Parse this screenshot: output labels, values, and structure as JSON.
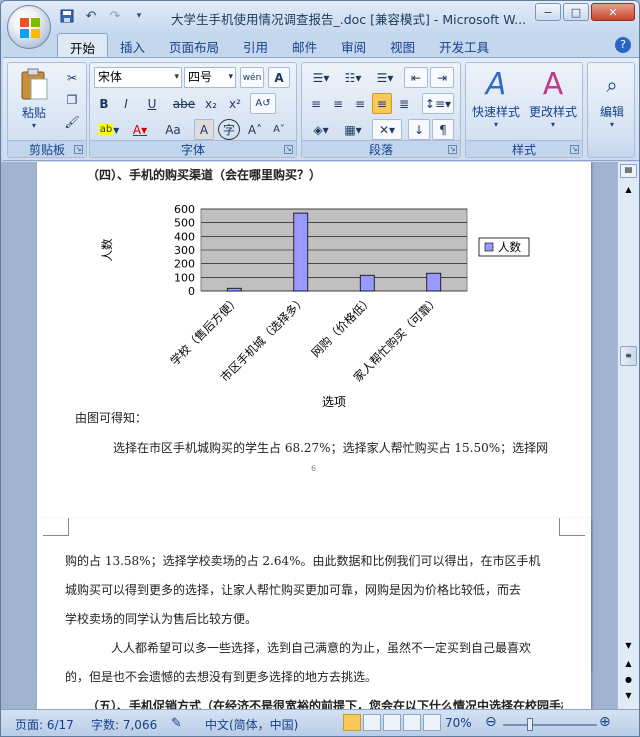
{
  "window": {
    "title": "大学生手机使用情况调查报告_.doc [兼容模式] - Microsoft W...",
    "min": "−",
    "max": "□",
    "close": "✕"
  },
  "qat": {
    "save_icon": "save-icon",
    "undo": "↶",
    "redo": "↷",
    "more": "▾"
  },
  "tabs": [
    "开始",
    "插入",
    "页面布局",
    "引用",
    "邮件",
    "审阅",
    "视图",
    "开发工具"
  ],
  "ribbon": {
    "clipboard": {
      "label": "剪贴板",
      "paste": "粘贴"
    },
    "font": {
      "label": "字体",
      "font_name": "宋体",
      "font_size": "四号",
      "wen": "wén",
      "a_box": "A",
      "bold": "B",
      "italic": "I",
      "underline": "U",
      "strike": "abe",
      "sub": "x₂",
      "sup": "x²",
      "aa": "Aa",
      "grow": "A˄",
      "shrink": "A˅",
      "char_shade": "A",
      "phonetic": "字"
    },
    "paragraph": {
      "label": "段落"
    },
    "styles": {
      "label": "样式",
      "quick": "快速样式",
      "change": "更改样式"
    },
    "editing": {
      "label": "编辑"
    }
  },
  "doc": {
    "heading_top": "（四）、手机的购买渠道（会在哪里购买？）",
    "after_chart": "由图可得知：",
    "para1_line1": "选择在市区手机城购买的学生占 68.27%；选择家人帮忙购买占 15.50%；选择网",
    "page_num": "6",
    "p2_line1": "购的占 13.58%；选择学校卖场的占 2.64%。由此数据和比例我们可以得出，在市区手机",
    "p2_line2": "城购买可以得到更多的选择，让家人帮忙购买更加可靠，网购是因为价格比较低，而去",
    "p2_line3": "学校卖场的同学认为售后比较方便。",
    "p3_line1": "人人都希望可以多一些选择，选到自己满意的为止，虽然不一定买到自己最喜欢",
    "p3_line2": "的，但是也不会遗憾的去想没有到更多选择的地方去挑选。",
    "heading_bottom": "（五）、手机促销方式（在经济不是很宽裕的前提下，您会在以下什么情况中选择在校园手机卖场"
  },
  "chart_data": {
    "type": "bar",
    "categories": [
      "学校（售后方便）",
      "市区手机城（选择多）",
      "网购（价格低）",
      "家人帮忙购买（可靠）"
    ],
    "series": [
      {
        "name": "人数",
        "values": [
          20,
          570,
          115,
          130
        ]
      }
    ],
    "xlabel": "选项",
    "ylabel": "人数",
    "ylim": [
      0,
      600
    ],
    "yticks": [
      0,
      100,
      200,
      300,
      400,
      500,
      600
    ],
    "grid": true,
    "legend": "right",
    "bar_color": "#9999ff",
    "plot_bg": "#c0c0c0"
  },
  "status": {
    "page": "页面: 6/17",
    "words": "字数: 7,066",
    "lang": "中文(简体，中国)",
    "zoom": "70%"
  }
}
